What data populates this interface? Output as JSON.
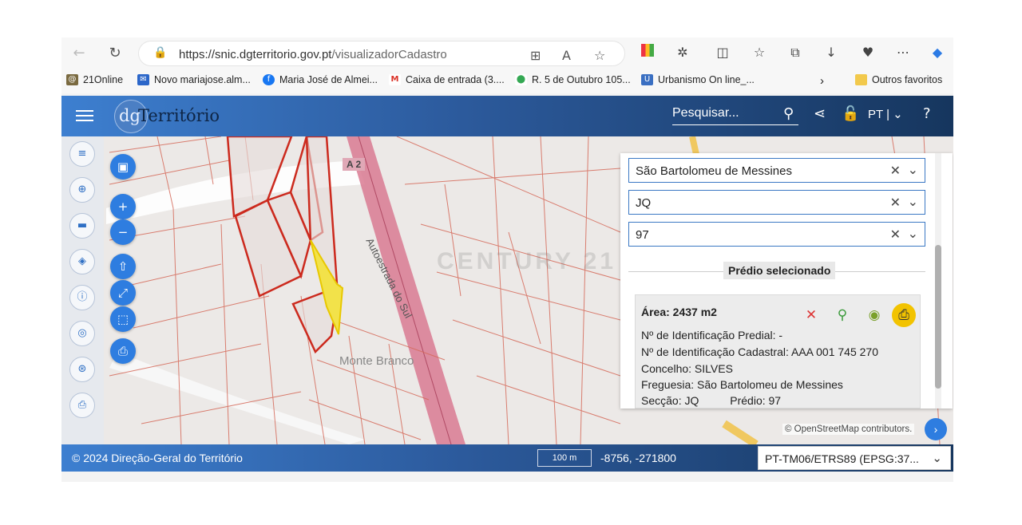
{
  "browser": {
    "url_host": "https://snic.dgterritorio.gov.pt",
    "url_path": "/visualizadorCadastro",
    "bookmarks": [
      {
        "label": "21Online",
        "icon": "21online-icon",
        "color": "#7a6a40"
      },
      {
        "label": "Novo mariajose.alm...",
        "icon": "mail-icon",
        "color": "#2b66c9"
      },
      {
        "label": "Maria José de Almei...",
        "icon": "facebook-icon",
        "color": "#1877f2"
      },
      {
        "label": "Caixa de entrada (3....",
        "icon": "gmail-icon",
        "color": "#d93025"
      },
      {
        "label": "R. 5 de Outubro 105...",
        "icon": "map-pin-icon",
        "color": "#34a853"
      },
      {
        "label": "Urbanismo On line_...",
        "icon": "urbanismo-icon",
        "color": "#3a6fc2"
      }
    ],
    "other_favorites": "Outros favoritos"
  },
  "app": {
    "logo_mark": "dg",
    "logo_text": "Território",
    "search_placeholder": "Pesquisar...",
    "lang": "PT"
  },
  "map": {
    "road_label": "A 2",
    "road_name": "Autoestrada do Sul",
    "place": "Monte Branco",
    "watermark": "CENTURY 21",
    "attribution": "© OpenStreetMap contributors."
  },
  "panel": {
    "freguesia_select": "São Bartolomeu de Messines",
    "seccao_select": "JQ",
    "predio_select": "97",
    "section_title": "Prédio selecionado",
    "area": "Área: 2437 m2",
    "lines": [
      "Nº de Identificação Predial: -",
      "Nº de Identificação Cadastral: AAA 001 745 270",
      "Concelho: SILVES",
      "Freguesia: São Bartolomeu de Messines",
      "Secção: JQ          Prédio: 97"
    ]
  },
  "footer": {
    "copyright": "© 2024 Direção-Geral do Território",
    "scale": "100 m",
    "coords": "-8756, -271800",
    "projection": "PT-TM06/ETRS89 (EPSG:37..."
  },
  "colors": {
    "header_blue": "#2c5a9c",
    "parcel_line": "#d23a2a",
    "selected_parcel": "#f2e24a",
    "highway": "#d97a92"
  }
}
